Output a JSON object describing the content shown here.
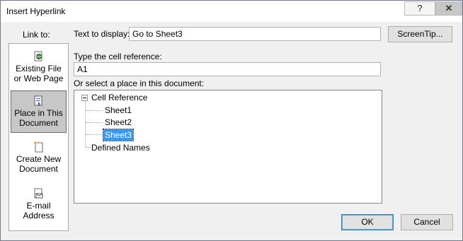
{
  "window": {
    "title": "Insert Hyperlink",
    "help_glyph": "?",
    "close_glyph": "✕"
  },
  "sidebar": {
    "heading": "Link to:",
    "items": [
      {
        "line1": "Existing File",
        "line2": "or Web Page",
        "icon": "existing-file-icon"
      },
      {
        "line1": "Place in This",
        "line2": "Document",
        "icon": "place-in-document-icon",
        "active": true
      },
      {
        "line1": "Create New",
        "line2": "Document",
        "icon": "new-document-icon"
      },
      {
        "line1": "E-mail",
        "line2": "Address",
        "icon": "email-icon"
      }
    ]
  },
  "form": {
    "text_to_display_label": "Text to display:",
    "text_to_display_value": "Go to Sheet3",
    "screentip_label": "ScreenTip...",
    "cell_ref_label": "Type the cell reference:",
    "cell_ref_value": "A1",
    "select_place_label": "Or select a place in this document:"
  },
  "tree": {
    "root": "Cell Reference",
    "children": [
      "Sheet1",
      "Sheet2",
      "Sheet3"
    ],
    "selected": "Sheet3",
    "second_root": "Defined Names"
  },
  "buttons": {
    "ok": "OK",
    "cancel": "Cancel"
  },
  "colors": {
    "selection": "#3399ff",
    "active_sidebar": "#c7c7c7"
  }
}
